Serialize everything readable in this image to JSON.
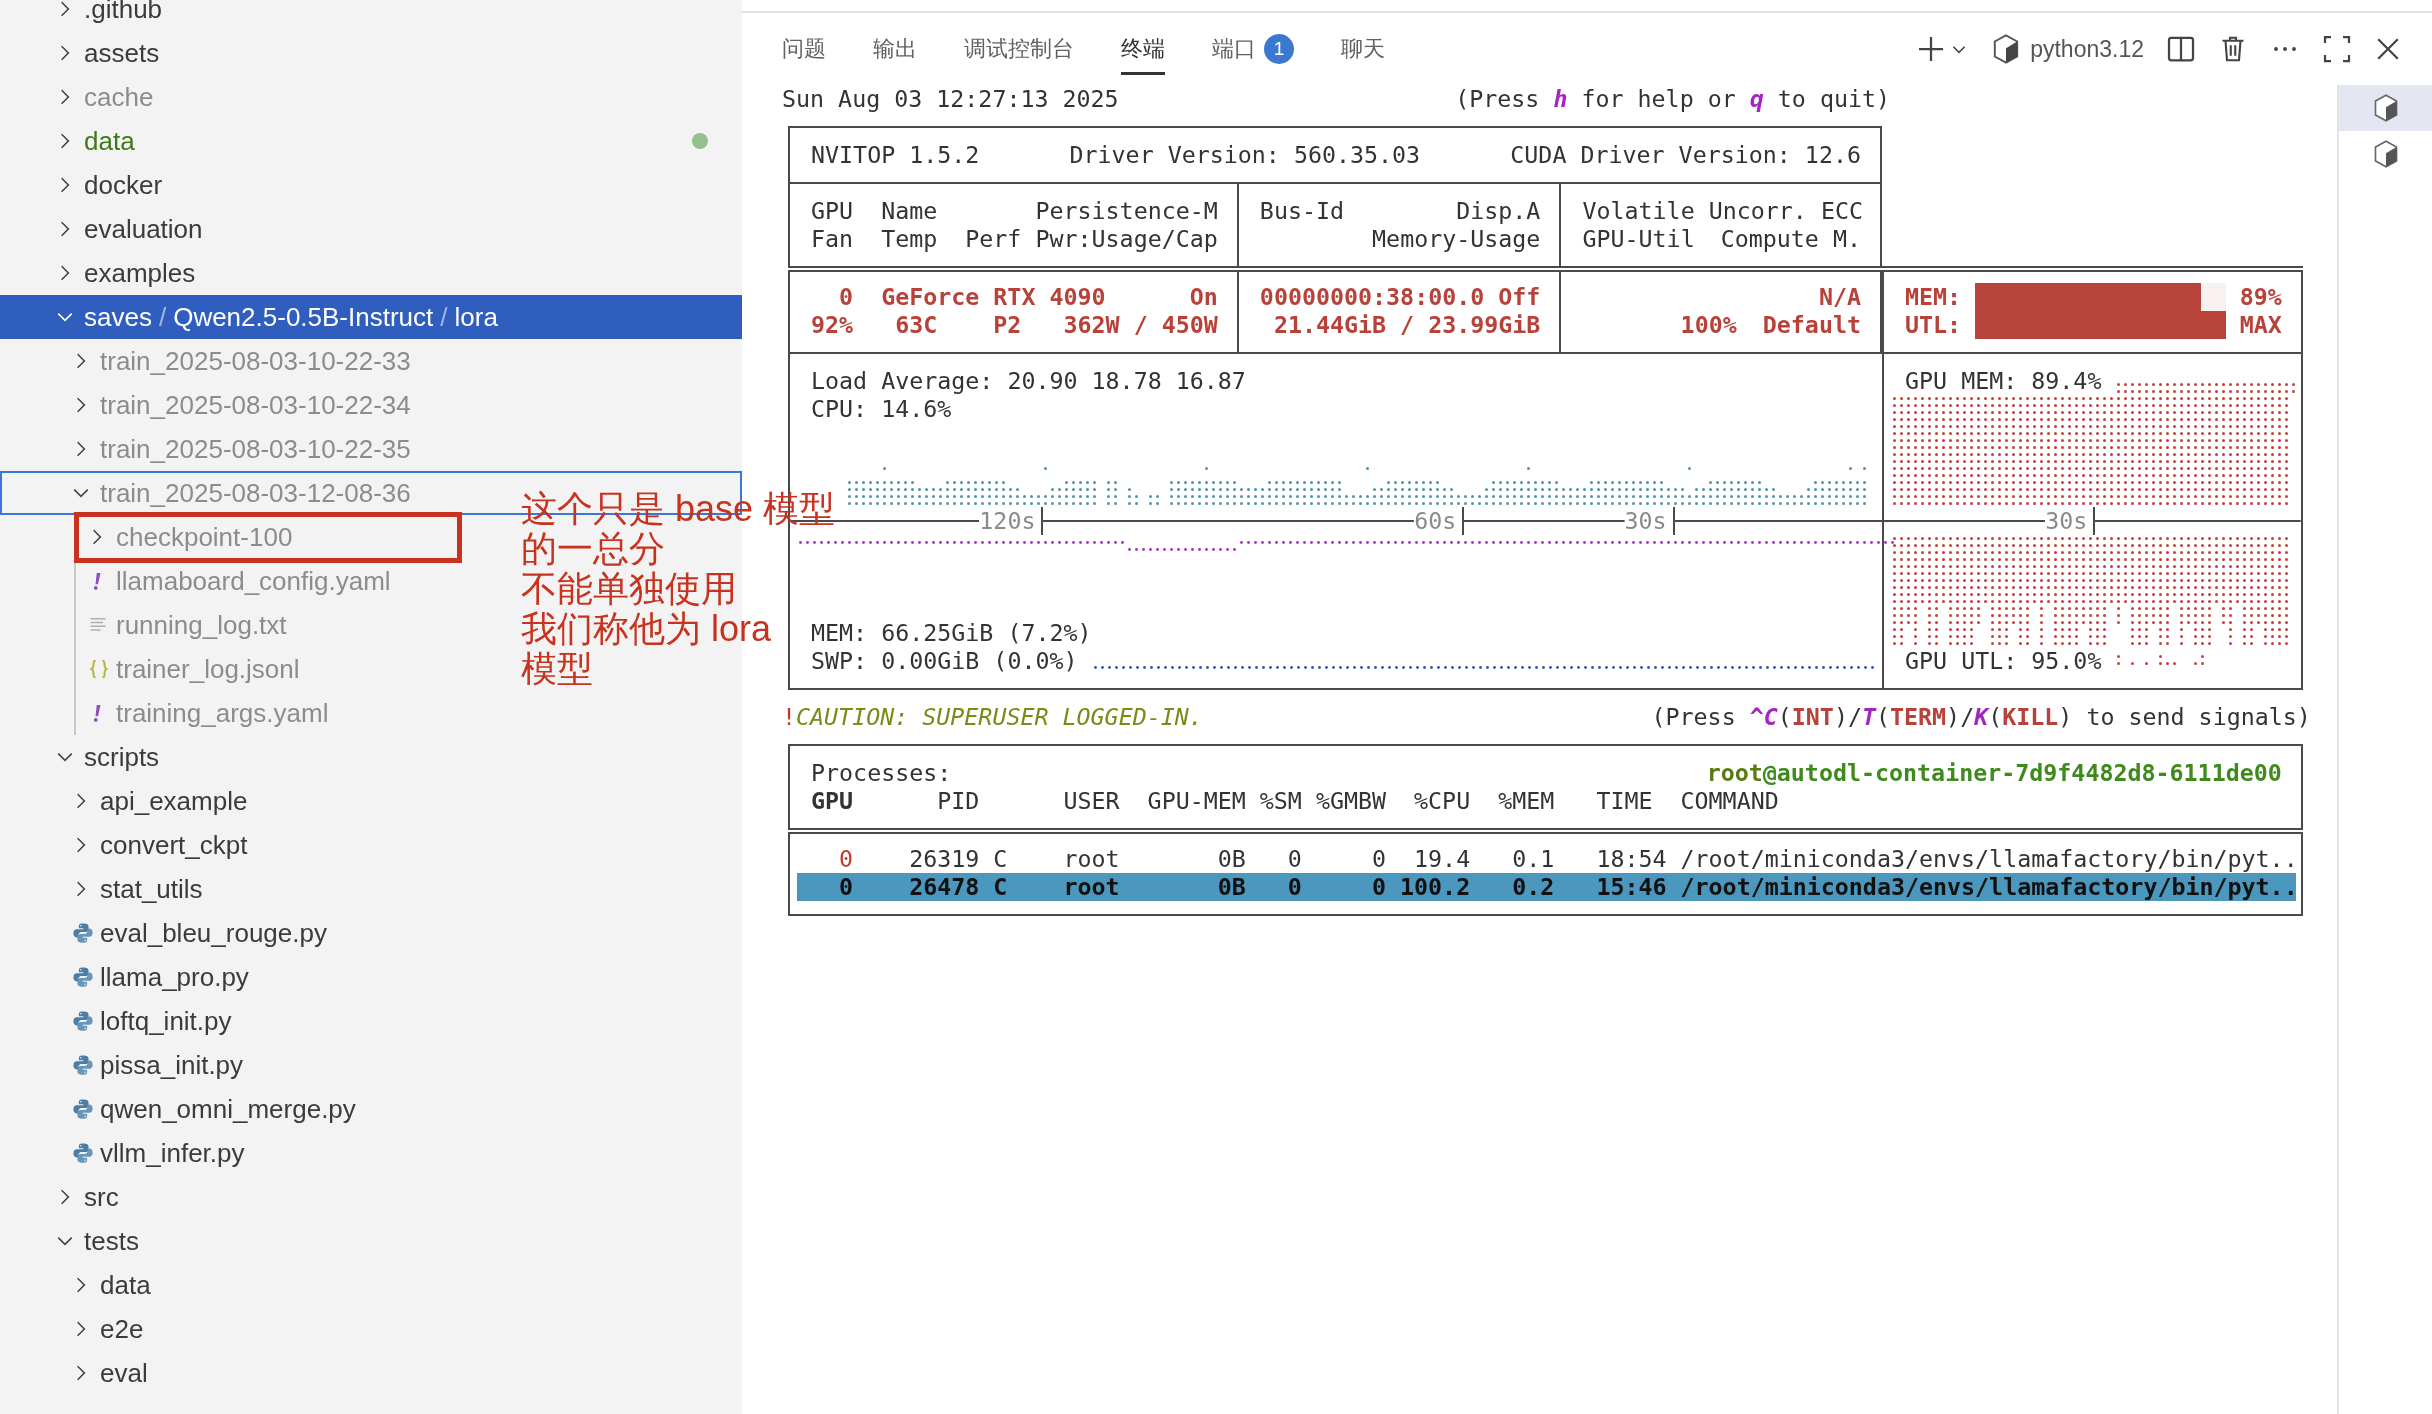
{
  "sidebar": {
    "items": [
      {
        "label": ".github",
        "kind": "folder",
        "expanded": false,
        "selected": false
      },
      {
        "label": "assets",
        "kind": "folder",
        "expanded": false,
        "selected": false
      },
      {
        "label": "cache",
        "kind": "folder",
        "expanded": false,
        "selected": false,
        "ignored": true
      },
      {
        "label": "data",
        "kind": "folder",
        "expanded": false,
        "selected": false,
        "added": true
      },
      {
        "label": "docker",
        "kind": "folder",
        "expanded": false,
        "selected": false
      },
      {
        "label": "evaluation",
        "kind": "folder",
        "expanded": false,
        "selected": false
      },
      {
        "label": "examples",
        "kind": "folder",
        "expanded": false,
        "selected": false
      },
      {
        "segments": [
          "saves",
          "Qwen2.5-0.5B-Instruct",
          "lora"
        ],
        "separator": "/",
        "kind": "folder",
        "expanded": true,
        "selected": true,
        "children": [
          {
            "label": "train_2025-08-03-10-22-33",
            "kind": "folder",
            "expanded": false,
            "selected": false,
            "ignored": true
          },
          {
            "label": "train_2025-08-03-10-22-34",
            "kind": "folder",
            "expanded": false,
            "selected": false,
            "ignored": true
          },
          {
            "label": "train_2025-08-03-10-22-35",
            "kind": "folder",
            "expanded": false,
            "selected": false,
            "ignored": true
          },
          {
            "label": "train_2025-08-03-12-08-36",
            "kind": "folder",
            "expanded": true,
            "selected": false,
            "focused": true,
            "ignored": true,
            "children": [
              {
                "label": "checkpoint-100",
                "kind": "folder",
                "expanded": false,
                "selected": false,
                "highlighted": true,
                "ignored": true
              },
              {
                "label": "llamaboard_config.yaml",
                "kind": "yaml",
                "selected": false,
                "ignored": true
              },
              {
                "label": "running_log.txt",
                "kind": "text",
                "selected": false,
                "ignored": true
              },
              {
                "label": "trainer_log.jsonl",
                "kind": "json",
                "selected": false,
                "ignored": true
              },
              {
                "label": "training_args.yaml",
                "kind": "yaml",
                "selected": false,
                "ignored": true
              }
            ]
          }
        ]
      },
      {
        "label": "scripts",
        "kind": "folder",
        "expanded": true,
        "selected": false,
        "children": [
          {
            "label": "api_example",
            "kind": "folder",
            "expanded": false,
            "selected": false
          },
          {
            "label": "convert_ckpt",
            "kind": "folder",
            "expanded": false,
            "selected": false
          },
          {
            "label": "stat_utils",
            "kind": "folder",
            "expanded": false,
            "selected": false
          },
          {
            "label": "eval_bleu_rouge.py",
            "kind": "python",
            "selected": false
          },
          {
            "label": "llama_pro.py",
            "kind": "python",
            "selected": false
          },
          {
            "label": "loftq_init.py",
            "kind": "python",
            "selected": false
          },
          {
            "label": "pissa_init.py",
            "kind": "python",
            "selected": false
          },
          {
            "label": "qwen_omni_merge.py",
            "kind": "python",
            "selected": false
          },
          {
            "label": "vllm_infer.py",
            "kind": "python",
            "selected": false
          }
        ]
      },
      {
        "label": "src",
        "kind": "folder",
        "expanded": false,
        "selected": false
      },
      {
        "label": "tests",
        "kind": "folder",
        "expanded": true,
        "selected": false,
        "children": [
          {
            "label": "data",
            "kind": "folder",
            "expanded": false,
            "selected": false
          },
          {
            "label": "e2e",
            "kind": "folder",
            "expanded": false,
            "selected": false
          },
          {
            "label": "eval",
            "kind": "folder",
            "expanded": false,
            "selected": false
          }
        ]
      }
    ]
  },
  "annotation": {
    "lines": [
      "这个只是 base 模型",
      "的一总分",
      "不能单独使用",
      "我们称他为 lora",
      "模型"
    ]
  },
  "panel": {
    "tabs": [
      {
        "label": "问题",
        "selected": false
      },
      {
        "label": "输出",
        "selected": false
      },
      {
        "label": "调试控制台",
        "selected": false
      },
      {
        "label": "终端",
        "selected": true
      },
      {
        "label": "端口",
        "selected": false,
        "badge": "1"
      },
      {
        "label": "聊天",
        "selected": false
      }
    ],
    "shell": "python3.12",
    "terminal_instances": [
      {
        "selected": true
      },
      {
        "selected": false
      }
    ]
  },
  "terminal": {
    "timestamp": "Sun Aug 03 12:27:13 2025",
    "help_hint": [
      {
        "text": "(Press ",
        "kind": "plain"
      },
      {
        "text": "h",
        "kind": "key"
      },
      {
        "text": " for help or ",
        "kind": "plain"
      },
      {
        "text": "q",
        "kind": "key"
      },
      {
        "text": " to quit)",
        "kind": "plain"
      }
    ],
    "header": {
      "version": "NVITOP 1.5.2",
      "driver": "Driver Version: 560.35.03",
      "cuda": "CUDA Driver Version: 12.6"
    },
    "columns": {
      "gpu": "GPU",
      "name": "Name",
      "persistence": "Persistence-M",
      "fan": "Fan",
      "temp": "Temp",
      "perf": "Perf",
      "power": "Pwr:Usage/Cap",
      "bus_id": "Bus-Id",
      "display": "Disp.A",
      "memory_usage": "Memory-Usage",
      "ecc": "Volatile Uncorr. ECC",
      "gpu_util": "GPU-Util",
      "compute_mode": "Compute M."
    },
    "device": {
      "index": "0",
      "name": "GeForce RTX 4090",
      "persistence": "On",
      "fan": "92%",
      "temp": "63C",
      "perf": "P2",
      "power": "362W / 450W",
      "bus_id": "00000000:38:00.0",
      "display": "Off",
      "memory_usage": "21.44GiB / 23.99GiB",
      "ecc": "N/A",
      "gpu_util": "100%",
      "compute_mode": "Default",
      "meters": [
        {
          "label": "MEM:",
          "level": 0.9,
          "reading": "89%"
        },
        {
          "label": "UTL:",
          "level": 1,
          "reading": "MAX"
        }
      ]
    },
    "host": {
      "load_average": "Load Average: 20.90 18.78 16.87",
      "cpu": "CPU: 14.6%",
      "mem": "MEM: 66.25GiB (7.2%)",
      "swap": "SWP: 0.00GiB (0.0%)",
      "time_labels": [
        "120s",
        "60s",
        "30s"
      ],
      "gpu_mem": "GPU MEM: 89.4%",
      "gpu_util": "GPU UTL: 95.0%",
      "gpu_time_label": "30s"
    },
    "caution": [
      {
        "text": "!",
        "kind": "alert"
      },
      {
        "text": "CAUTION: SUPERUSER LOGGED-IN.",
        "kind": "warning"
      }
    ],
    "signal_hint": [
      {
        "text": "(Press ",
        "kind": "plain"
      },
      {
        "text": "^C",
        "kind": "key"
      },
      {
        "text": "(",
        "kind": "plain"
      },
      {
        "text": "INT",
        "kind": "signal"
      },
      {
        "text": ")/",
        "kind": "plain"
      },
      {
        "text": "T",
        "kind": "key"
      },
      {
        "text": "(",
        "kind": "plain"
      },
      {
        "text": "TERM",
        "kind": "signal"
      },
      {
        "text": ")/",
        "kind": "plain"
      },
      {
        "text": "K",
        "kind": "key"
      },
      {
        "text": "(",
        "kind": "plain"
      },
      {
        "text": "KILL",
        "kind": "signal"
      },
      {
        "text": ") to send signals)",
        "kind": "plain"
      }
    ],
    "processes": {
      "title": "Processes:",
      "user": "root",
      "host": "@autodl-container-7d9f4482d8-6111de00",
      "columns": [
        "GPU",
        "PID",
        "USER",
        "GPU-MEM",
        "%SM",
        "%GMBW",
        "%CPU",
        "%MEM",
        "TIME",
        "COMMAND"
      ],
      "rows": [
        {
          "selected": false,
          "cells": [
            "0",
            "26319 C",
            "root",
            "0B",
            "0",
            "0",
            "19.4",
            "0.1",
            "18:54",
            "/root/miniconda3/envs/llamafactory/bin/pyt.."
          ]
        },
        {
          "selected": true,
          "cells": [
            "0",
            "26478 C",
            "root",
            "0B",
            "0",
            "0",
            "100.2",
            "0.2",
            "15:46",
            "/root/miniconda3/envs/llamafactory/bin/pyt.."
          ]
        }
      ]
    }
  }
}
